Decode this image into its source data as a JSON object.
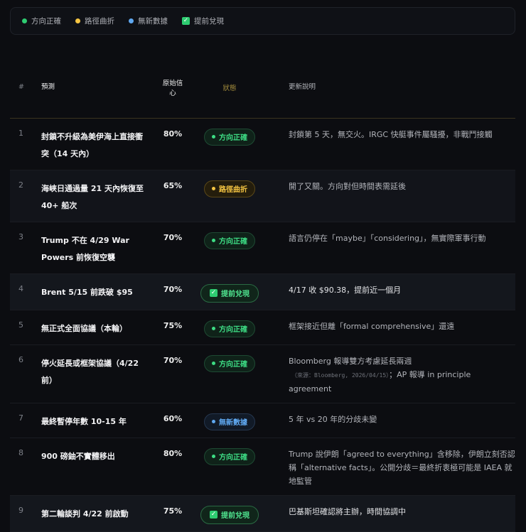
{
  "legend": [
    {
      "label": "方向正確",
      "color": "#2ecc71",
      "type": "dot"
    },
    {
      "label": "路徑曲折",
      "color": "#f5c542",
      "type": "dot"
    },
    {
      "label": "無新數據",
      "color": "#5fa8f0",
      "type": "dot"
    },
    {
      "label": "提前兌現",
      "color": "#2ecc71",
      "type": "check"
    }
  ],
  "headers": {
    "num": "#",
    "prediction": "預測",
    "confidence": "原始信心",
    "status": "狀態",
    "update": "更新說明"
  },
  "rows": [
    {
      "num": "1",
      "prediction": "封鎖不升級為美伊海上直接衝突（14 天內）",
      "confidence": "80%",
      "status": "方向正確",
      "kind": "g",
      "update": "封鎖第 5 天，無交火。IRGC 快艇事件屬騷擾，非戰鬥接觸"
    },
    {
      "num": "2",
      "prediction": "海峽日通過量 21 天內恢復至 40+ 船次",
      "confidence": "65%",
      "status": "路徑曲折",
      "kind": "y",
      "update": "開了又關。方向對但時間表需延後"
    },
    {
      "num": "3",
      "prediction": "Trump 不在 4/29 War Powers 前恢復空襲",
      "confidence": "70%",
      "status": "方向正確",
      "kind": "g",
      "update": "語言仍停在「maybe」「considering」，無實際軍事行動"
    },
    {
      "num": "4",
      "prediction": "Brent 5/15 前跌破 $95",
      "confidence": "70%",
      "status": "提前兌現",
      "kind": "e",
      "update": "4/17 收 $90.38，提前近一個月"
    },
    {
      "num": "5",
      "prediction": "無正式全面協議（本輪）",
      "confidence": "75%",
      "status": "方向正確",
      "kind": "g",
      "update": "框架接近但離「formal comprehensive」還遠"
    },
    {
      "num": "6",
      "prediction": "停火延長或框架協議（4/22 前）",
      "confidence": "70%",
      "status": "方向正確",
      "kind": "g",
      "update": "Bloomberg 報導雙方考慮延長兩週",
      "source": "（來源：Bloomberg, 2026/04/15）",
      "update_tail": "；AP 報導 in principle agreement"
    },
    {
      "num": "7",
      "prediction": "最終暫停年數 10-15 年",
      "confidence": "60%",
      "status": "無新數據",
      "kind": "b",
      "update": "5 年 vs 20 年的分歧未變"
    },
    {
      "num": "8",
      "prediction": "900 磅鈾不實體移出",
      "confidence": "80%",
      "status": "方向正確",
      "kind": "g",
      "update": "Trump 說伊朗「agreed to everything」含移除，伊朗立刻否認稱「alternative facts」。公開分歧＝最終折衷極可能是 IAEA 就地監管"
    },
    {
      "num": "9",
      "prediction": "第二輪談判 4/22 前啟動",
      "confidence": "75%",
      "status": "提前兌現",
      "kind": "e",
      "update": "巴基斯坦確認將主辦，時間協調中"
    }
  ]
}
